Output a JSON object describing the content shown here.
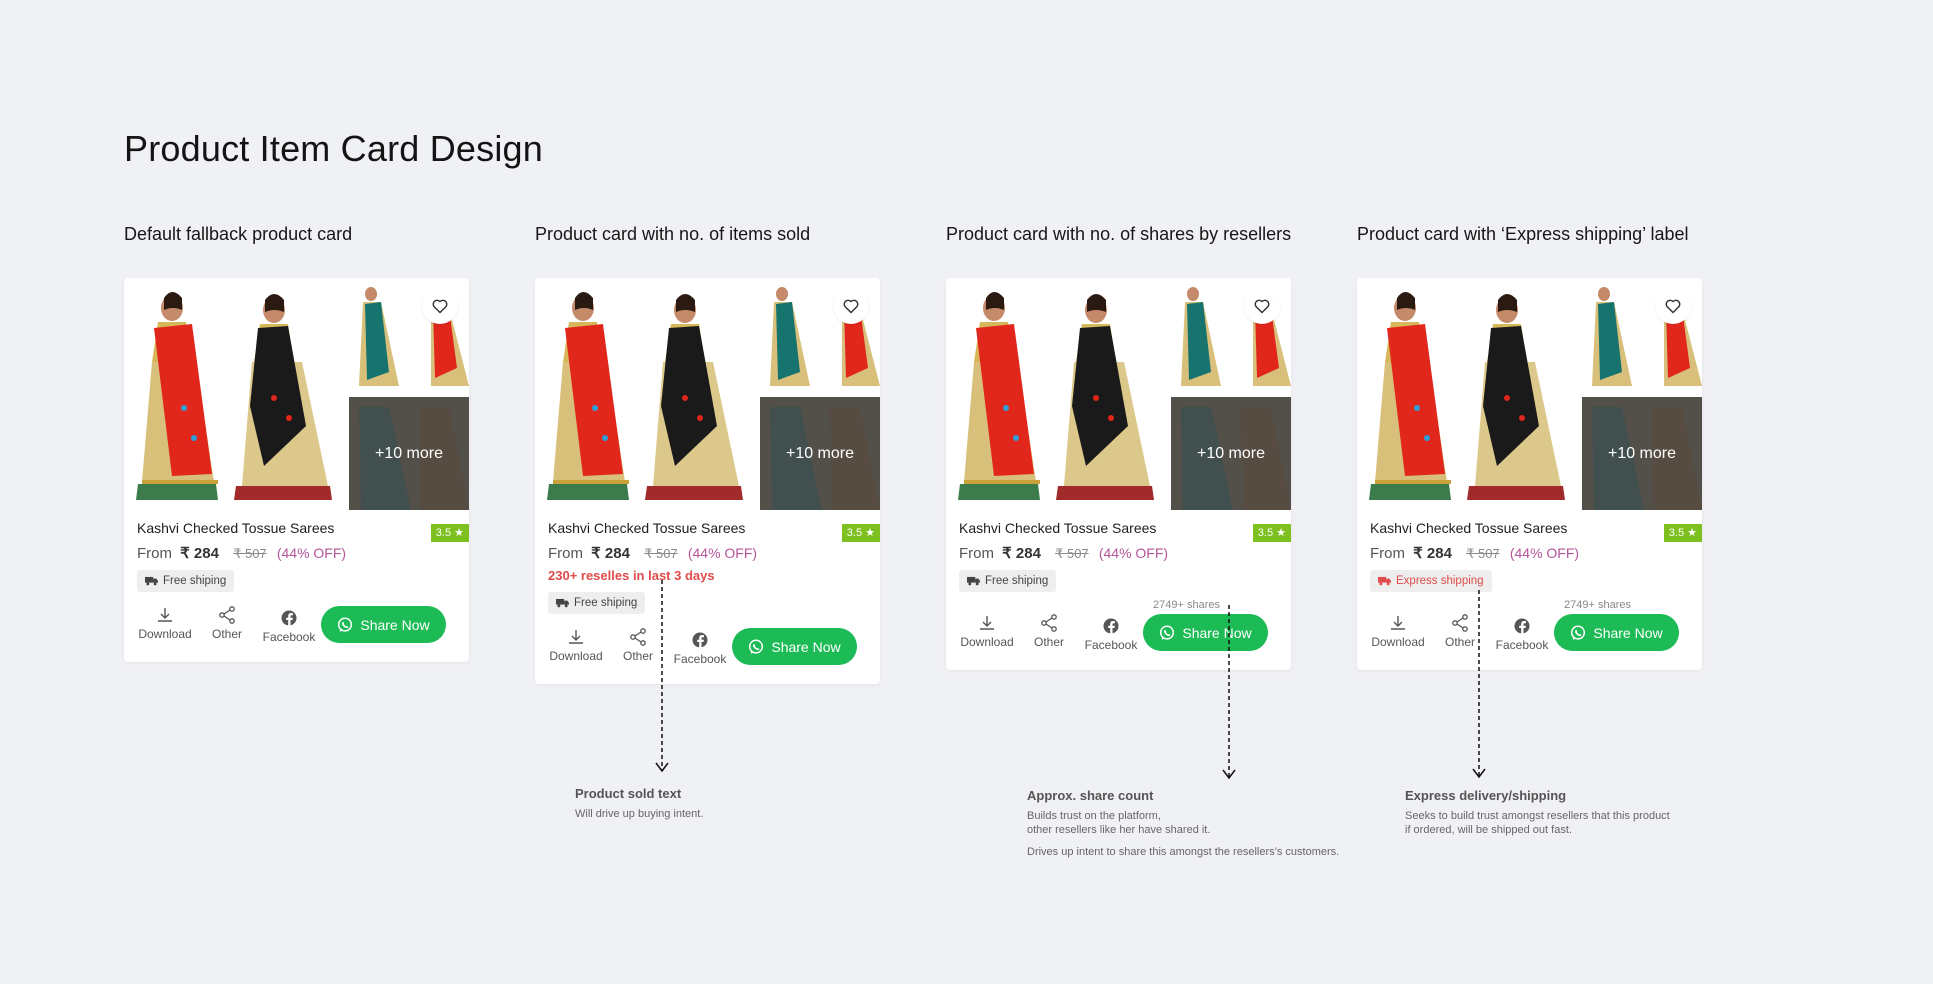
{
  "page": {
    "title": "Product Item Card Design"
  },
  "colors": {
    "background": "#f0f1f5",
    "share_green": "#1dbb56",
    "rating_green": "#7dc01f",
    "discount_pink": "#b5559a",
    "alert_red": "#e04b4b"
  },
  "cards": [
    {
      "heading": "Default fallback product card",
      "product_name": "Kashvi Checked Tossue Sarees",
      "rating": "3.5 ★",
      "from_label": "From",
      "price": "₹ 284",
      "mrp": "₹ 507",
      "discount": "(44% OFF)",
      "more_label": "+10 more",
      "shipping_label": "Free shiping",
      "actions": {
        "download": "Download",
        "other": "Other",
        "facebook": "Facebook"
      },
      "share_button": "Share Now"
    },
    {
      "heading": "Product card with no. of items sold",
      "product_name": "Kashvi Checked Tossue Sarees",
      "rating": "3.5 ★",
      "from_label": "From",
      "price": "₹ 284",
      "mrp": "₹ 507",
      "discount": "(44% OFF)",
      "more_label": "+10 more",
      "sold_text": "230+ reselles in last 3 days",
      "shipping_label": "Free shiping",
      "actions": {
        "download": "Download",
        "other": "Other",
        "facebook": "Facebook"
      },
      "share_button": "Share Now"
    },
    {
      "heading": "Product card with no. of shares by resellers",
      "product_name": "Kashvi Checked Tossue Sarees",
      "rating": "3.5 ★",
      "from_label": "From",
      "price": "₹ 284",
      "mrp": "₹ 507",
      "discount": "(44% OFF)",
      "more_label": "+10 more",
      "shipping_label": "Free shiping",
      "shares_count": "2749+ shares",
      "actions": {
        "download": "Download",
        "other": "Other",
        "facebook": "Facebook"
      },
      "share_button": "Share Now"
    },
    {
      "heading": "Product card with ‘Express shipping’ label",
      "product_name": "Kashvi Checked Tossue Sarees",
      "rating": "3.5 ★",
      "from_label": "From",
      "price": "₹ 284",
      "mrp": "₹ 507",
      "discount": "(44% OFF)",
      "more_label": "+10 more",
      "shipping_label": "Express shipping",
      "shares_count": "2749+ shares",
      "actions": {
        "download": "Download",
        "other": "Other",
        "facebook": "Facebook"
      },
      "share_button": "Share Now"
    }
  ],
  "notes": {
    "sold": {
      "title": "Product sold text",
      "lines": [
        "Will drive up buying intent."
      ]
    },
    "shares": {
      "title": "Approx. share count",
      "lines": [
        "Builds trust on the platform,",
        "other resellers like her have shared it.",
        "Drives up intent to share this amongst the resellers’s customers."
      ]
    },
    "express": {
      "title": "Express delivery/shipping",
      "lines": [
        "Seeks to build trust amongst resellers that this product",
        "if ordered, will be shipped out fast."
      ]
    }
  },
  "icons": [
    "heart-icon",
    "truck-icon",
    "download-icon",
    "share-icon",
    "facebook-icon",
    "whatsapp-icon",
    "arrow-down-icon"
  ]
}
